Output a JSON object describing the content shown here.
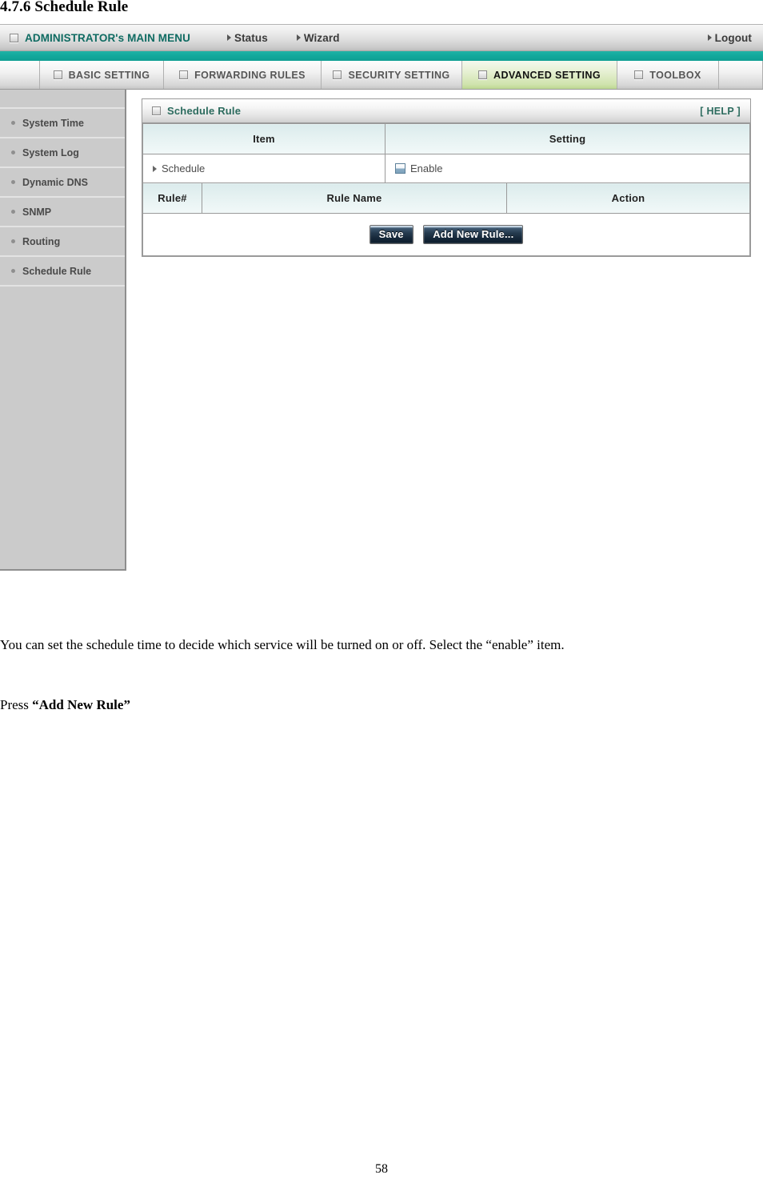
{
  "document": {
    "heading": "4.7.6 Schedule Rule",
    "page_number": "58",
    "paragraphs": {
      "intro": "You can set the schedule time to decide which service will be turned on or off. Select the “enable” item.",
      "press_prefix": "Press ",
      "press_emphasis": "“Add New Rule”"
    }
  },
  "router_ui": {
    "admin_bar": {
      "title": "ADMINISTRATOR's MAIN MENU",
      "links": [
        {
          "label": "Status"
        },
        {
          "label": "Wizard"
        },
        {
          "label": "Logout"
        }
      ],
      "title_color": "#0f6b62",
      "accent_color": "#13a99c"
    },
    "tabs": [
      {
        "label": "BASIC SETTING",
        "active": false
      },
      {
        "label": "FORWARDING RULES",
        "active": false
      },
      {
        "label": "SECURITY SETTING",
        "active": false
      },
      {
        "label": "ADVANCED SETTING",
        "active": true
      },
      {
        "label": "TOOLBOX",
        "active": false
      }
    ],
    "sidebar": {
      "items": [
        {
          "label": "System Time"
        },
        {
          "label": "System Log"
        },
        {
          "label": "Dynamic DNS"
        },
        {
          "label": "SNMP"
        },
        {
          "label": "Routing"
        },
        {
          "label": "Schedule Rule"
        }
      ]
    },
    "panel": {
      "title": "Schedule Rule",
      "help_label": "[ HELP ]",
      "settings_table": {
        "headers": [
          "Item",
          "Setting"
        ],
        "rows": [
          {
            "item": "Schedule",
            "setting": "Enable",
            "control": "checkbox",
            "checked": false
          }
        ]
      },
      "rules_table": {
        "headers": [
          "Rule#",
          "Rule Name",
          "Action"
        ],
        "rows": []
      },
      "buttons": [
        {
          "label": "Save"
        },
        {
          "label": "Add New Rule..."
        }
      ]
    }
  }
}
